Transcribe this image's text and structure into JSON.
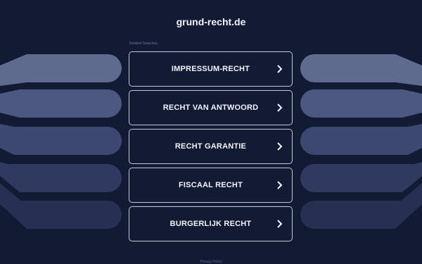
{
  "site": {
    "domain": "grund-recht.de"
  },
  "related_searches_label": "Related Searches",
  "links": [
    {
      "label": "IMPRESSUM-RECHT"
    },
    {
      "label": "RECHT VAN ANTWOORD"
    },
    {
      "label": "RECHT GARANTIE"
    },
    {
      "label": "FISCAAL RECHT"
    },
    {
      "label": "BURGERLIJK RECHT"
    }
  ],
  "footer": {
    "privacy": "Privacy Policy"
  },
  "colors": {
    "background": "#131a33",
    "stripe_light": "#5e6b8f",
    "stripe_dark": "#252f52",
    "button_border": "#c4c9d7",
    "text": "#f2f4fa"
  },
  "icons": {
    "link_arrow": "chevron-right-icon"
  }
}
